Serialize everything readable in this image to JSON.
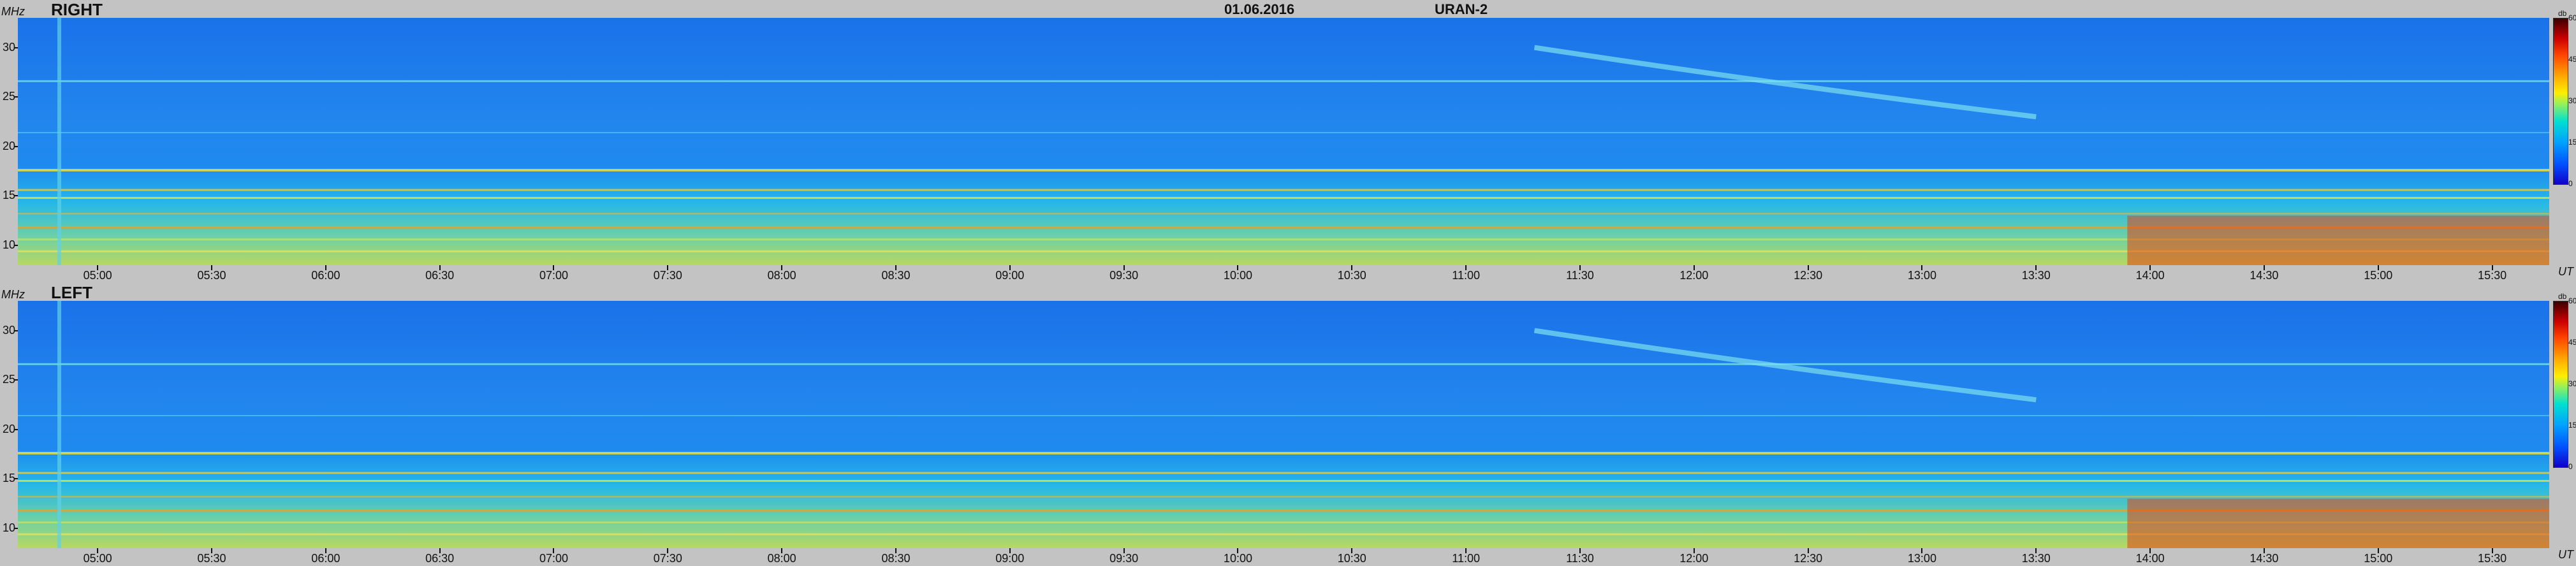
{
  "header": {
    "date": "01.06.2016",
    "instrument": "URAN-2"
  },
  "chart_data": [
    {
      "type": "heatmap",
      "title": "RIGHT",
      "ylabel": "MHz",
      "xlabel": "UT",
      "colorbar_unit": "db",
      "colorbar_ticks": [
        "60",
        "45",
        "30",
        "15",
        "0"
      ],
      "yticks": [
        "30",
        "25",
        "20",
        "15",
        "10"
      ],
      "xticks": [
        "05:00",
        "05:30",
        "06:00",
        "06:30",
        "07:00",
        "07:30",
        "08:00",
        "08:30",
        "09:00",
        "09:30",
        "10:00",
        "10:30",
        "11:00",
        "11:30",
        "12:00",
        "12:30",
        "13:00",
        "13:30",
        "14:00",
        "14:30",
        "15:00",
        "15:30"
      ],
      "ylim": [
        8,
        33
      ],
      "xlim_hours": [
        4.65,
        15.75
      ],
      "clim": [
        0,
        60
      ]
    },
    {
      "type": "heatmap",
      "title": "LEFT",
      "ylabel": "MHz",
      "xlabel": "UT",
      "colorbar_unit": "db",
      "colorbar_ticks": [
        "60",
        "45",
        "30",
        "15",
        "0"
      ],
      "yticks": [
        "30",
        "25",
        "20",
        "15",
        "10"
      ],
      "xticks": [
        "05:00",
        "05:30",
        "06:00",
        "06:30",
        "07:00",
        "07:30",
        "08:00",
        "08:30",
        "09:00",
        "09:30",
        "10:00",
        "10:30",
        "11:00",
        "11:30",
        "12:00",
        "12:30",
        "13:00",
        "13:30",
        "14:00",
        "14:30",
        "15:00",
        "15:30"
      ],
      "ylim": [
        8,
        33
      ],
      "xlim_hours": [
        4.65,
        15.75
      ],
      "clim": [
        0,
        60
      ]
    }
  ],
  "colors": {
    "background": "#c3c3c3",
    "low": "#1a72e8",
    "mid": "#26b8e6",
    "high": "#ffee00",
    "max": "#cc0000"
  }
}
